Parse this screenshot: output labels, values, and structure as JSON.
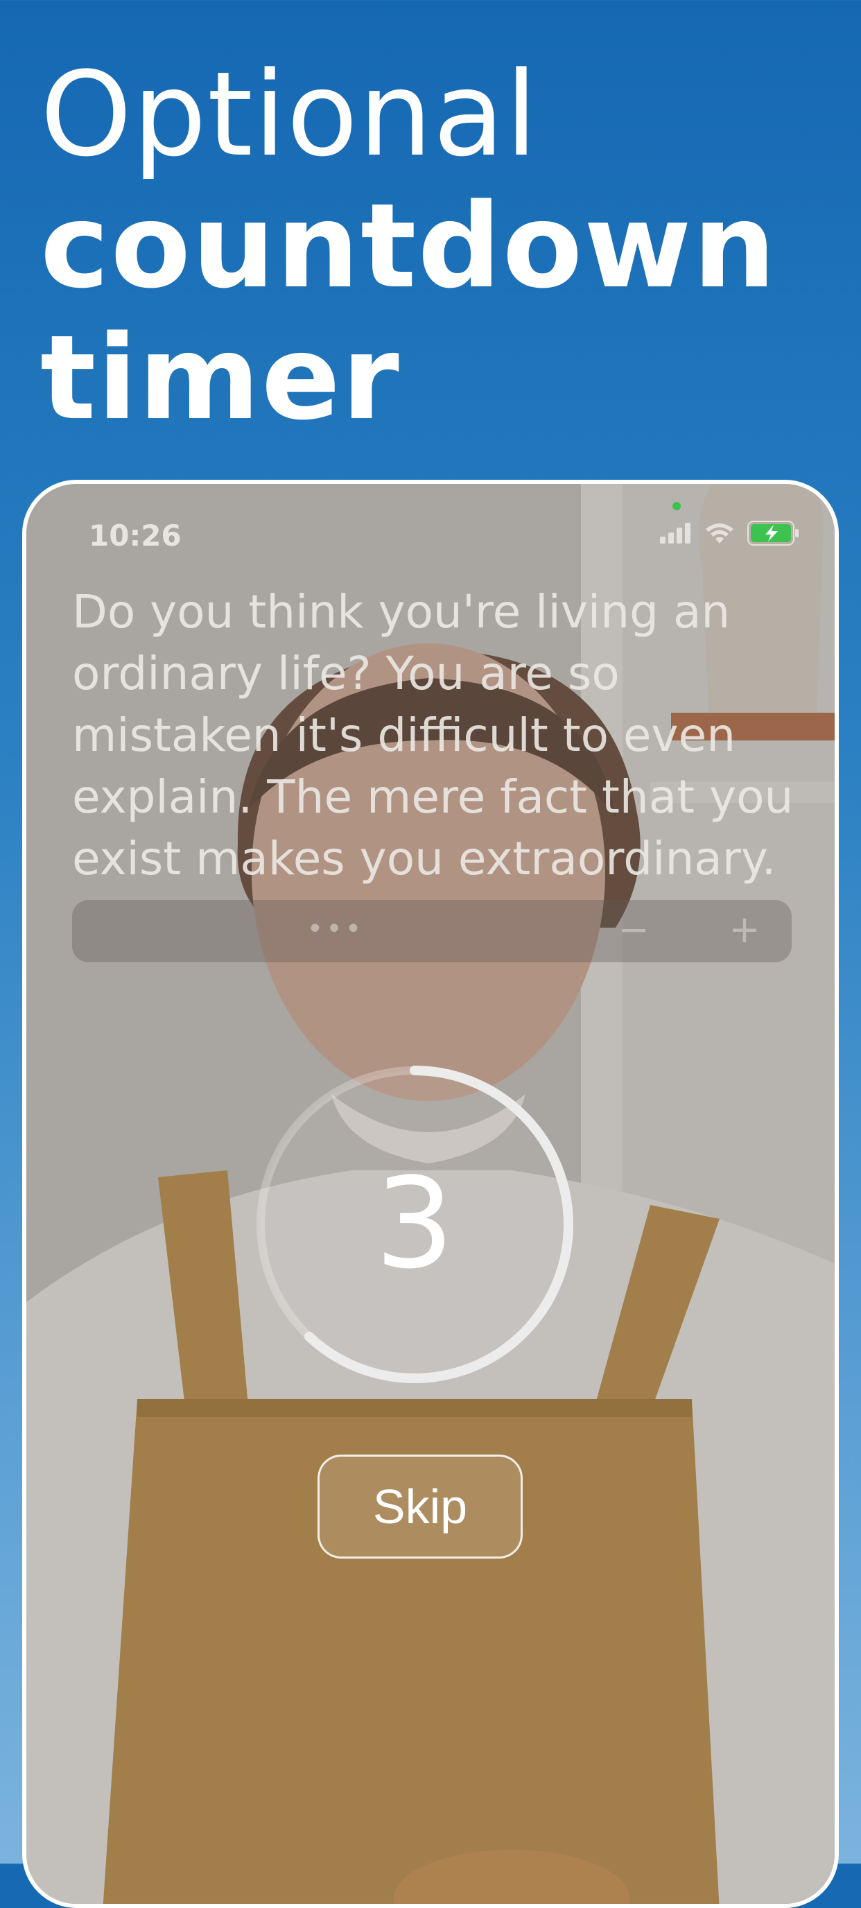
{
  "headline": {
    "line1": "Optional",
    "line2": "countdown",
    "line3": "timer"
  },
  "status_bar": {
    "time": "10:26",
    "icons": [
      "cellular-signal-icon",
      "wifi-icon",
      "battery-charging-icon"
    ]
  },
  "quote": {
    "text": "Do you think you're living an ordinary life? You are so mistaken it's difficult to even explain. The mere fact that you exist makes you extraordinary."
  },
  "toolbar": {
    "more_label": "•••",
    "decrease_label": "−",
    "increase_label": "+"
  },
  "countdown": {
    "value": "3",
    "progress": 0.62
  },
  "skip_button": {
    "label": "Skip"
  },
  "colors": {
    "background_top": "#1568b2",
    "background_bottom": "#7bb3de",
    "text": "#ffffff",
    "battery": "#3cc24f"
  }
}
